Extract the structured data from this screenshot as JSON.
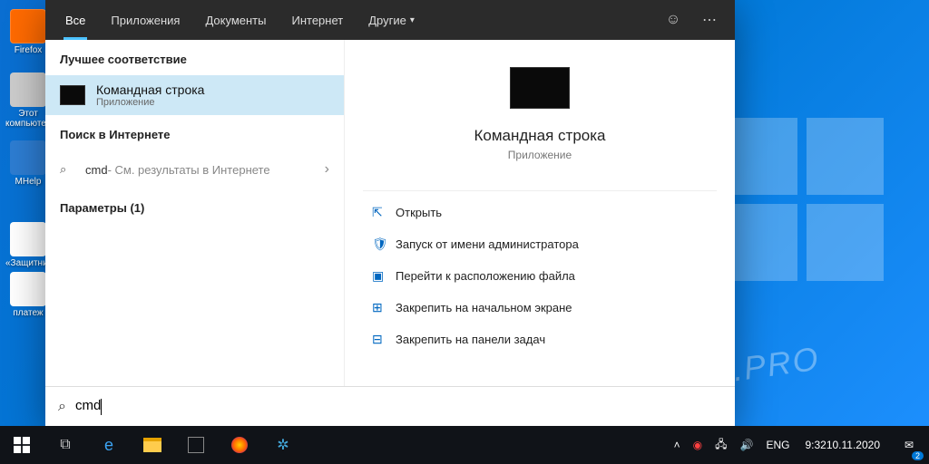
{
  "desktop": {
    "icons": [
      "Firefox",
      "Этот компьютер",
      "MHelp",
      "«Защитник»",
      "платеж"
    ]
  },
  "search": {
    "tabs": {
      "all": "Все",
      "apps": "Приложения",
      "docs": "Документы",
      "web": "Интернет",
      "more": "Другие"
    },
    "sections": {
      "best": "Лучшее соответствие",
      "websearch": "Поиск в Интернете",
      "settings": "Параметры (1)"
    },
    "bestMatch": {
      "title": "Командная строка",
      "subtitle": "Приложение"
    },
    "webResult": {
      "query": "cmd",
      "hint": " - См. результаты в Интернете"
    },
    "preview": {
      "title": "Командная строка",
      "subtitle": "Приложение"
    },
    "actions": {
      "open": "Открыть",
      "runAdmin": "Запуск от имени администратора",
      "openLocation": "Перейти к расположению файла",
      "pinStart": "Закрепить на начальном экране",
      "pinTaskbar": "Закрепить на панели задач"
    },
    "input": {
      "value": "cmd"
    }
  },
  "tray": {
    "lang": "ENG",
    "time": "9:32",
    "date": "10.11.2020",
    "notifCount": "2"
  },
  "watermark": "MHELP.PRO"
}
